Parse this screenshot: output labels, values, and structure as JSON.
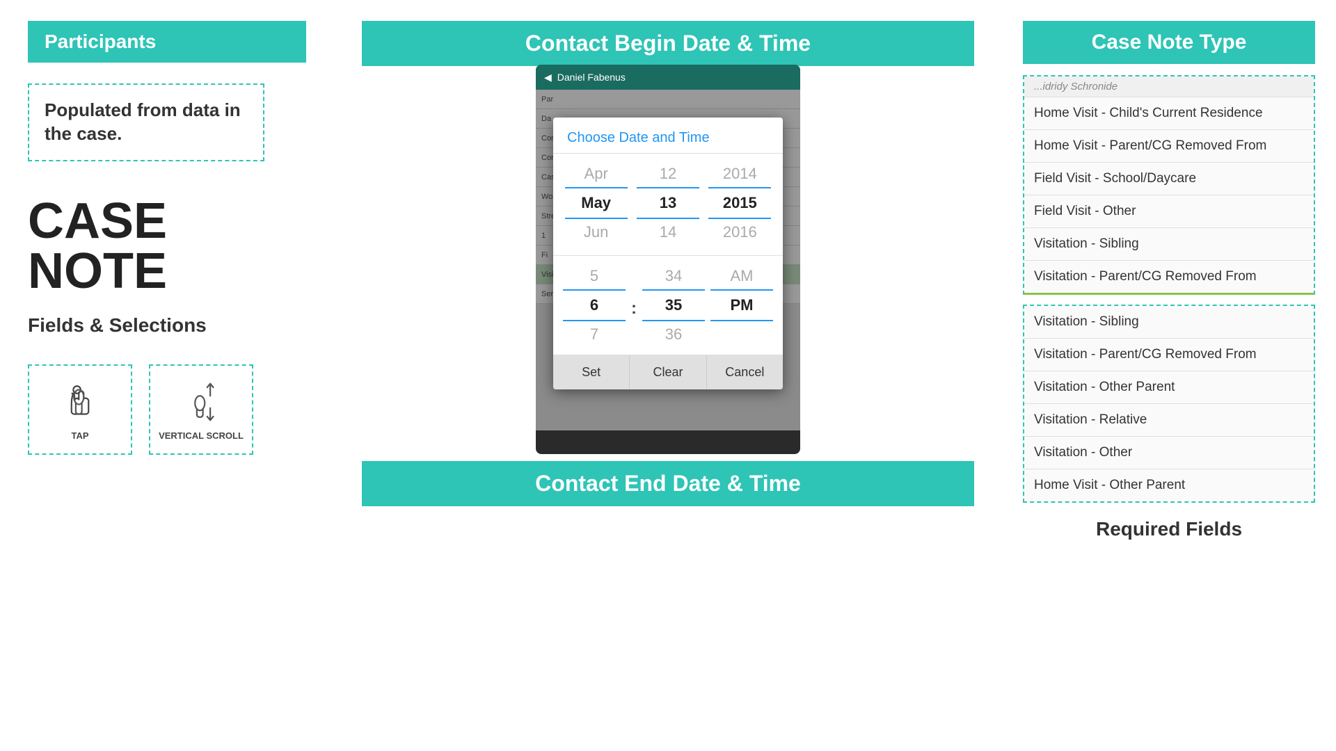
{
  "left": {
    "participants_header": "Participants",
    "populated_text": "Populated from data in the case.",
    "case_note_title": "CASE NOTE",
    "fields_subtitle": "Fields & Selections",
    "tap_label": "TAP",
    "scroll_label": "VERTICAL SCROLL"
  },
  "center": {
    "contact_begin_header": "Contact Begin Date & Time",
    "contact_end_header": "Contact End Date & Time",
    "phone_status": "Daniel Fabenus",
    "dialog": {
      "title": "Choose Date and Time",
      "date_prev_month": "Apr",
      "date_curr_month": "May",
      "date_next_month": "Jun",
      "date_prev_day": "12",
      "date_curr_day": "13",
      "date_next_day": "14",
      "date_prev_year": "2014",
      "date_curr_year": "2015",
      "date_next_year": "2016",
      "time_prev_hour": "5",
      "time_curr_hour": "6",
      "time_next_hour": "7",
      "time_sep": ":",
      "time_prev_min": "34",
      "time_curr_min": "35",
      "time_next_min": "36",
      "time_prev_ampm": "AM",
      "time_curr_ampm": "PM",
      "btn_set": "Set",
      "btn_clear": "Clear",
      "btn_cancel": "Cancel"
    },
    "app_rows": [
      {
        "label": "Par",
        "type": "normal"
      },
      {
        "label": "Da",
        "type": "normal"
      },
      {
        "label": "Con",
        "type": "normal"
      },
      {
        "label": "Con",
        "type": "normal"
      },
      {
        "label": "Cas",
        "type": "normal"
      },
      {
        "label": "Wor",
        "type": "normal"
      },
      {
        "label": "Stre",
        "type": "normal"
      },
      {
        "label": "1",
        "type": "normal"
      },
      {
        "label": "Fi",
        "type": "normal"
      },
      {
        "label": "Visi",
        "type": "green"
      },
      {
        "label": "Ser",
        "type": "normal"
      }
    ]
  },
  "right": {
    "case_note_type_header": "Case Note Type",
    "upper_list_header_stub": "...idridy Schronide",
    "upper_list": [
      "Home Visit - Child's Current Residence",
      "Home Visit - Parent/CG Removed From",
      "Field Visit - School/Daycare",
      "Field Visit - Other",
      "Visitation - Sibling",
      "Visitation - Parent/CG Removed From"
    ],
    "lower_list": [
      "Visitation - Sibling",
      "Visitation - Parent/CG Removed From",
      "Visitation - Other Parent",
      "Visitation - Relative",
      "Visitation - Other",
      "Home Visit - Other Parent"
    ],
    "required_fields_label": "Required Fields"
  }
}
